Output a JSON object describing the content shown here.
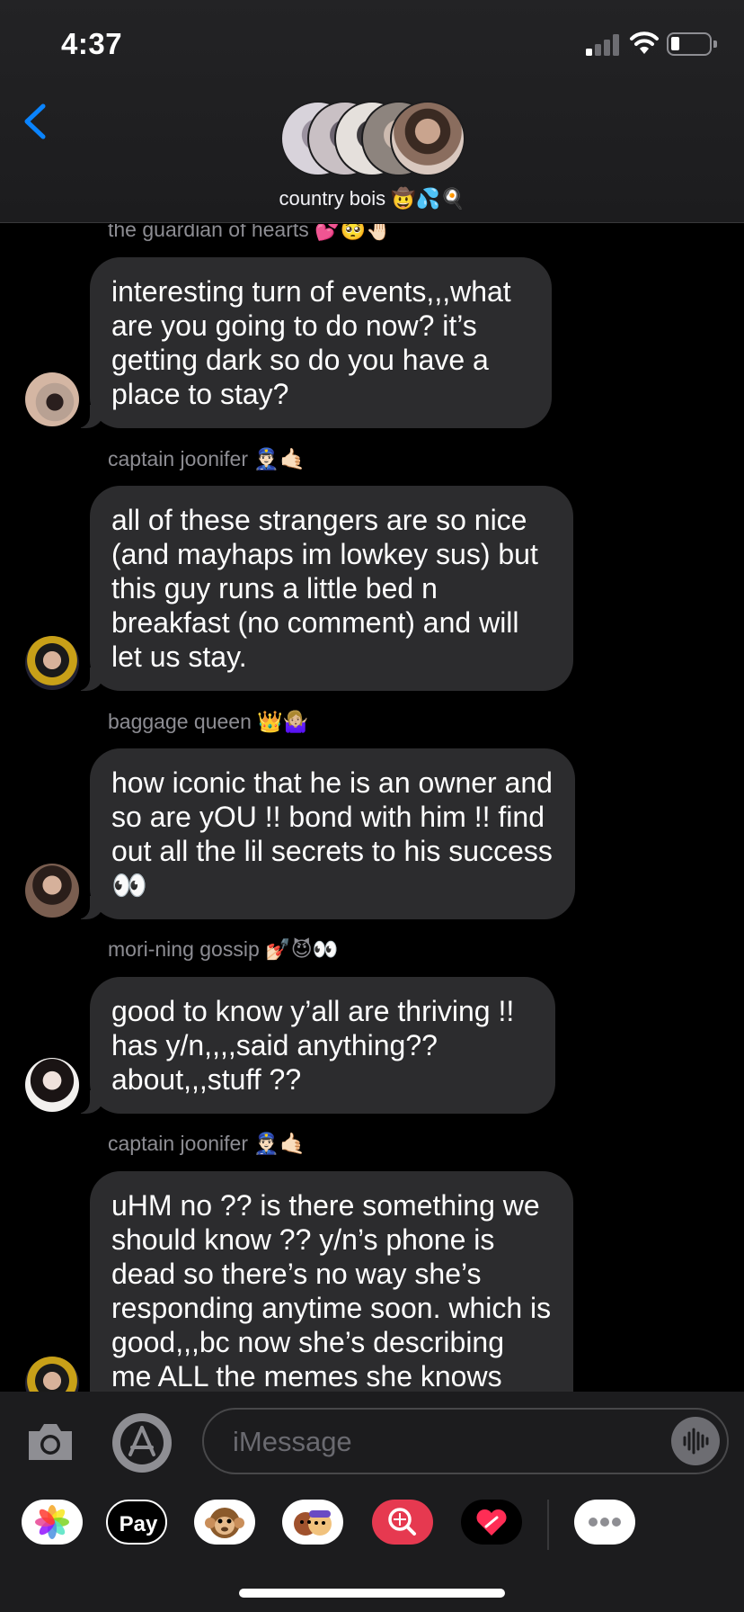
{
  "status_bar": {
    "time": "4:37",
    "icons": [
      "cellular-signal-icon",
      "wifi-icon",
      "battery-icon"
    ]
  },
  "header": {
    "back_icon": "chevron-left-icon",
    "group_name": "country bois 🤠💦🍳"
  },
  "messages": [
    {
      "sender": "the guardian of hearts 💕🥺🤚🏻",
      "text": "interesting turn of events,,,what are you going to do now? it’s getting dark so do you have a place to stay?"
    },
    {
      "sender": "captain joonifer 👮🏻‍♂️🤙🏻",
      "text": "all of these strangers are so nice (and mayhaps im lowkey sus) but this guy runs a little bed n breakfast (no comment) and will let us stay."
    },
    {
      "sender": "baggage queen 👑🤷🏼‍♀️",
      "text": "how iconic that he is an owner and so are yOU !! bond with him !! find out all the lil secrets to his success 👀"
    },
    {
      "sender": "mori-ning gossip 💅🏻😈👀",
      "text": "good to know y’all are thriving !! has y/n,,,,said anything?? about,,,stuff ??"
    },
    {
      "sender": "captain joonifer 👮🏻‍♂️🤙🏻",
      "text": "uHM no ?? is there something we should know ?? y/n’s phone is dead so there’s no way she’s responding anytime soon. which is good,,,bc now she’s describing me ALL the memes she knows"
    }
  ],
  "composer": {
    "placeholder": "iMessage",
    "camera_icon": "camera-icon",
    "appstore_icon": "app-store-icon",
    "audio_icon": "audio-waveform-icon"
  },
  "app_drawer": {
    "apps": [
      {
        "name": "photos-app-icon"
      },
      {
        "name": "apple-pay-app-icon",
        "label": "Pay"
      },
      {
        "name": "animoji-app-icon"
      },
      {
        "name": "memoji-stickers-app-icon"
      },
      {
        "name": "web-images-app-icon"
      },
      {
        "name": "digital-touch-app-icon"
      },
      {
        "name": "more-apps-icon"
      }
    ]
  },
  "colors": {
    "background": "#000000",
    "header_bg": "#1c1c1e",
    "bubble_gray": "#2c2c2e",
    "accent_blue": "#0a84ff",
    "sender_text": "#8d8d93"
  }
}
